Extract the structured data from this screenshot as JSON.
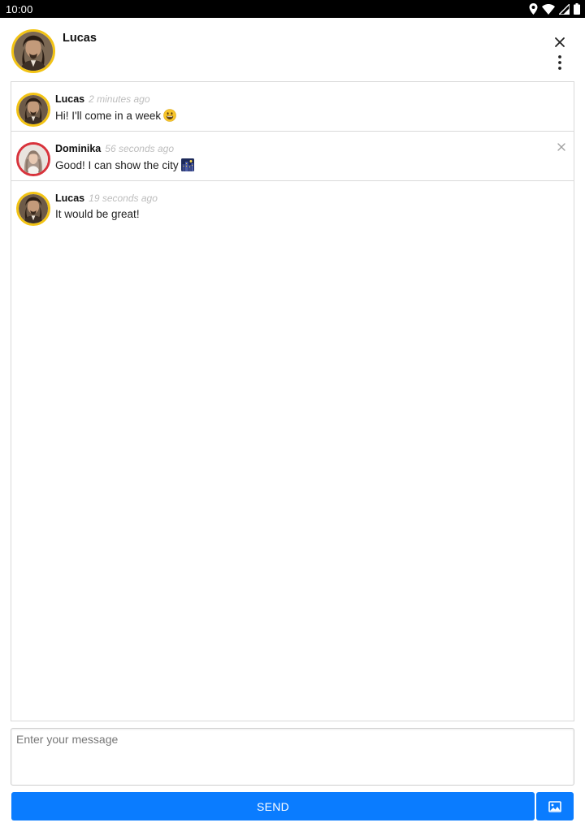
{
  "status_bar": {
    "time": "10:00",
    "icons": [
      "location-icon",
      "wifi-icon",
      "signal-icon",
      "battery-icon"
    ]
  },
  "header": {
    "name": "Lucas",
    "avatar_ring_color": "#f2c314",
    "close_icon": "close-icon",
    "menu_icon": "more-vertical-icon"
  },
  "messages": [
    {
      "author": "Lucas",
      "time": "2 minutes ago",
      "text": "Hi! I'll come in a week",
      "emoji": "smiley-emoji",
      "avatar_ring_color": "#f2c314"
    },
    {
      "author": "Dominika",
      "time": "56 seconds ago",
      "text": "Good! I can show the city",
      "emoji": "night-city-emoji",
      "avatar_ring_color": "#d8333c",
      "deletable": true
    },
    {
      "author": "Lucas",
      "time": "19 seconds ago",
      "text": "It would be great!",
      "avatar_ring_color": "#f2c314"
    }
  ],
  "composer": {
    "placeholder": "Enter your message",
    "value": "",
    "send_label": "SEND",
    "image_icon": "image-icon"
  },
  "colors": {
    "accent": "#0a7cff",
    "border": "#d9d9d9",
    "timestamp": "#bdbdbd"
  }
}
